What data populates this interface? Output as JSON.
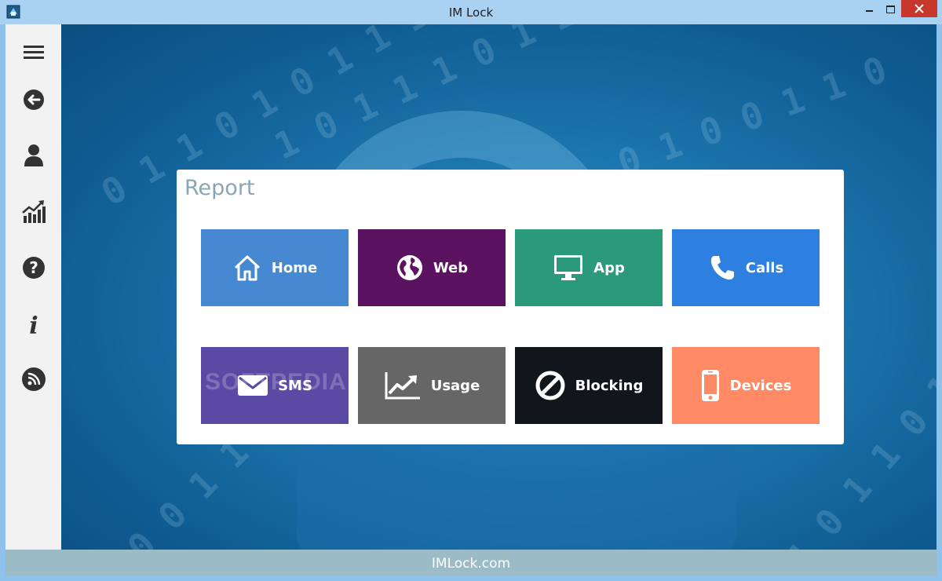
{
  "window": {
    "title": "IM Lock"
  },
  "footer": {
    "text": "IMLock.com"
  },
  "sidebar": {
    "items": [
      {
        "icon": "menu-icon"
      },
      {
        "icon": "back-arrow-icon"
      },
      {
        "icon": "user-icon"
      },
      {
        "icon": "chart-icon"
      },
      {
        "icon": "help-icon"
      },
      {
        "icon": "info-icon"
      },
      {
        "icon": "rss-icon"
      }
    ]
  },
  "panel": {
    "title": "Report",
    "tiles": [
      {
        "label": "Home",
        "icon": "home-icon",
        "color": "#4788d2"
      },
      {
        "label": "Web",
        "icon": "globe-icon",
        "color": "#5b1260"
      },
      {
        "label": "App",
        "icon": "monitor-icon",
        "color": "#2b9a7a"
      },
      {
        "label": "Calls",
        "icon": "phone-icon",
        "color": "#2d7fe0"
      },
      {
        "label": "SMS",
        "icon": "envelope-icon",
        "color": "#5a4aa4"
      },
      {
        "label": "Usage",
        "icon": "trend-chart-icon",
        "color": "#666666"
      },
      {
        "label": "Blocking",
        "icon": "block-icon",
        "color": "#10161c"
      },
      {
        "label": "Devices",
        "icon": "smartphone-icon",
        "color": "#ff8a65"
      }
    ],
    "watermark": "SOFTPEDIA"
  }
}
